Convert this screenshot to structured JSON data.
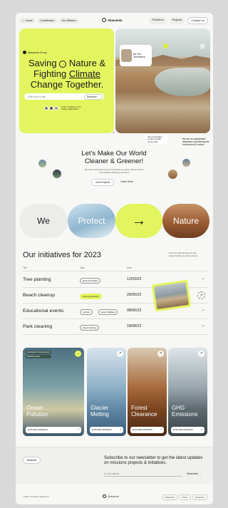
{
  "header": {
    "home": "← Home",
    "nav": [
      "Contribution",
      "Our Mission"
    ],
    "logo": "Akasamia",
    "right_nav": [
      "Problems",
      "Projects"
    ],
    "contact": "Contact Us"
  },
  "hero": {
    "badge": "Akasamia Group",
    "title_1": "Saving",
    "title_2": "Nature &",
    "title_3": "Fighting",
    "title_4": "Climate",
    "title_5": "Change Together.",
    "email_placeholder": "Enter your e-mail",
    "subscribe": "Subscribe →",
    "members_note": "1.5K+ members of our charity organization"
  },
  "hero_right": {
    "volunteer_card": "Be Our Volunteers",
    "community_chip": "Join our largest environmental community",
    "org_note": "We are an organization dedicated to protecting the environment & nature."
  },
  "mid": {
    "title": "Let's Make Our World Cleaner & Greener!",
    "subtitle": "We work with partners & communities to ensure nature thrives and climate change is reversed",
    "view_projects": "View Projects",
    "learn_more": "Learn More"
  },
  "strip": {
    "we": "We",
    "protect": "Protect",
    "arrow": "→",
    "nature": "Nature"
  },
  "initiatives": {
    "title": "Our initiatives for 2023",
    "note": "Find out what projects we are implementing to protect nature",
    "headers": {
      "title": "Title",
      "tags": "Tags",
      "date": "Date"
    },
    "rows": [
      {
        "name": "Tree planting",
        "tag": "green and cleans",
        "date": "12/03/23",
        "arrow": "→"
      },
      {
        "name": "Beach cleanup",
        "tag": "future generations",
        "date": "29/05/23",
        "arrow": "↗"
      },
      {
        "name": "Educational events",
        "tag": "courses",
        "tag2": "green initiatives",
        "date": "08/06/23",
        "arrow": "→"
      },
      {
        "name": "Park cleaning",
        "tag": "way of cleaning",
        "date": "18/08/23",
        "arrow": "→"
      }
    ]
  },
  "cards": [
    {
      "title_1": "Ocean",
      "title_2": "Pollution",
      "button": "EXPLORE PROBLEM",
      "chips": [
        "Endangered Oceanography",
        "Pollution Issues"
      ]
    },
    {
      "title_1": "Glacier",
      "title_2": "Melting",
      "button": "EXPLORE PROBLEM"
    },
    {
      "title_1": "Forest",
      "title_2": "Clearance",
      "button": "EXPLORE PROBLEM"
    },
    {
      "title_1": "GHG",
      "title_2": "Emissions",
      "button": "EXPLORE PROBLEM"
    }
  ],
  "newsletter": {
    "pill": "newsletter",
    "title": "Subscribe to our newsletter to get the latest updates on missions projects & initiatives.",
    "email_placeholder": "E-mail address",
    "subscribe": "Subscribe →"
  },
  "footer": {
    "copyright": "©2023. All Rights Reserved",
    "logo": "Akasamia",
    "links": [
      "Facebook",
      "Twitter",
      "Instagram"
    ]
  },
  "colors": {
    "accent": "#e3f55e",
    "page_bg": "#f7f7f5",
    "outer_bg": "#d9d9d9"
  }
}
